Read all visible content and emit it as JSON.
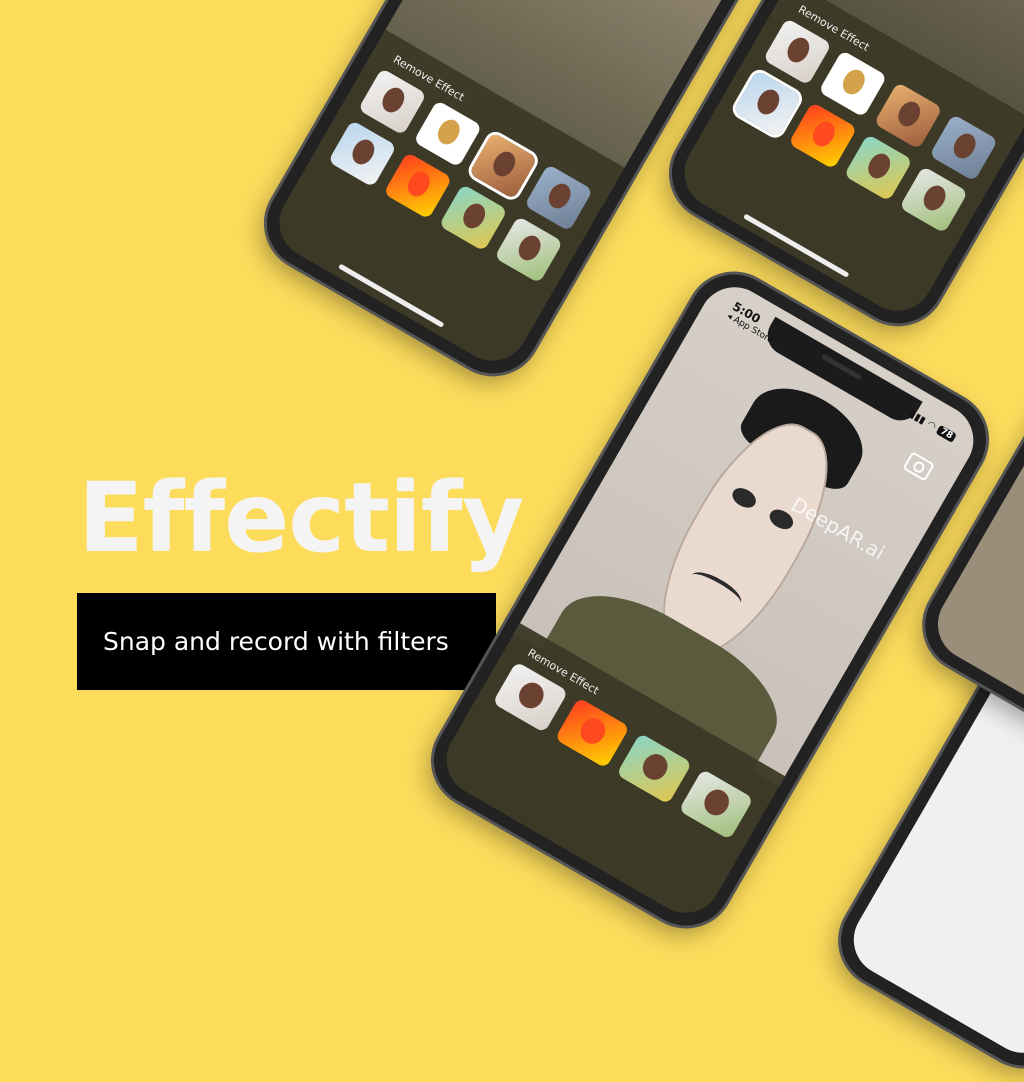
{
  "brand": {
    "name": "Effectify",
    "tagline": "Snap and record with filters"
  },
  "colors": {
    "background": "#fddc5c",
    "brand_text": "#f4f4f4",
    "tagline_bg": "#000000"
  },
  "phones": {
    "panel_title": "Remove Effect",
    "status": {
      "time": "5:00",
      "back_label": "◂ App Store",
      "battery": "78"
    },
    "watermark": "DeepAR.ai",
    "icons": [
      "camera-icon",
      "signal-icon",
      "wifi-icon",
      "battery-icon"
    ]
  }
}
